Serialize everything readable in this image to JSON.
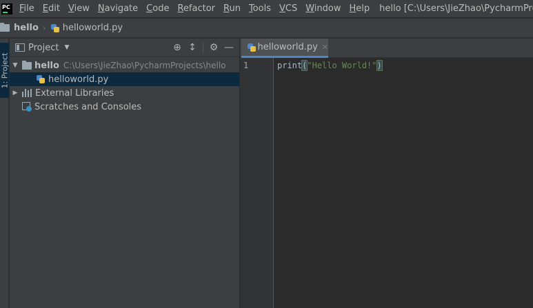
{
  "app": {
    "logo": "PC"
  },
  "menu": [
    {
      "mn": "F",
      "rest": "ile"
    },
    {
      "mn": "E",
      "rest": "dit"
    },
    {
      "mn": "V",
      "rest": "iew"
    },
    {
      "mn": "N",
      "rest": "avigate"
    },
    {
      "mn": "C",
      "rest": "ode"
    },
    {
      "mn": "R",
      "rest": "efactor"
    },
    {
      "mn": "R",
      "rest": "un"
    },
    {
      "mn": "T",
      "rest": "ools"
    },
    {
      "mn": "V",
      "rest": "CS"
    },
    {
      "mn": "W",
      "rest": "indow"
    },
    {
      "mn": "H",
      "rest": "elp"
    }
  ],
  "window_title": "hello [C:\\Users\\JieZhao\\PycharmProjects\\hello]",
  "breadcrumb": {
    "root": "hello",
    "file": "helloworld.py"
  },
  "left_strip": {
    "tab": "1: Project"
  },
  "project_panel": {
    "title": "Project",
    "tree": {
      "root_name": "hello",
      "root_path": "C:\\Users\\JieZhao\\PycharmProjects\\hello",
      "file": "helloworld.py",
      "external": "External Libraries",
      "scratches": "Scratches and Consoles"
    }
  },
  "editor": {
    "tab_label": "helloworld.py",
    "line_number": "1",
    "code": {
      "fn": "print",
      "open": "(",
      "str": "\"Hello World!\"",
      "close": ")"
    }
  },
  "colors": {
    "background": "#2b2b2b",
    "panel": "#3c3f41",
    "selection": "#0d293e",
    "tab_accent": "#4a88c7",
    "string": "#6a8759"
  },
  "icons": {
    "folder": "folder-icon",
    "python_file": "python-file-icon",
    "target": "locate-icon",
    "collapse": "collapse-all-icon",
    "settings": "gear-icon",
    "hide": "minimize-icon",
    "close": "close-icon"
  }
}
